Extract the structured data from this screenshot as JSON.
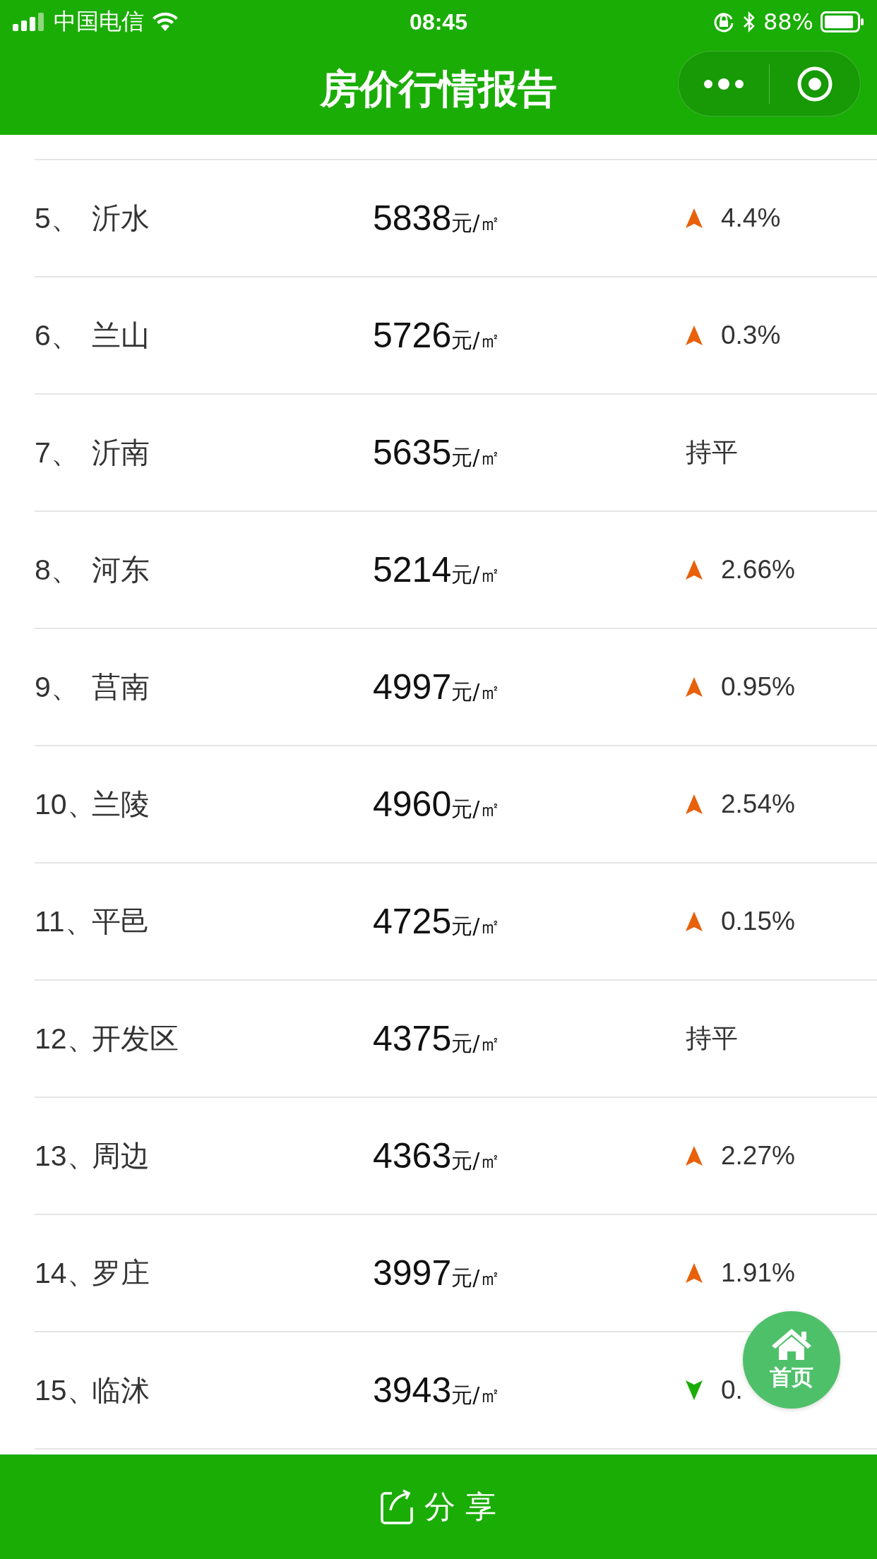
{
  "status_bar": {
    "carrier": "中国电信",
    "time": "08:45",
    "battery": "88%"
  },
  "nav_bar": {
    "title": "房价行情报告"
  },
  "rows": [
    {
      "rank": "5、",
      "name": "沂水",
      "price": "5838",
      "unit": "元/㎡",
      "trend": {
        "kind": "up",
        "text": "4.4%"
      }
    },
    {
      "rank": "6、",
      "name": "兰山",
      "price": "5726",
      "unit": "元/㎡",
      "trend": {
        "kind": "up",
        "text": "0.3%"
      }
    },
    {
      "rank": "7、",
      "name": "沂南",
      "price": "5635",
      "unit": "元/㎡",
      "trend": {
        "kind": "flat",
        "text": "持平"
      }
    },
    {
      "rank": "8、",
      "name": "河东",
      "price": "5214",
      "unit": "元/㎡",
      "trend": {
        "kind": "up",
        "text": "2.66%"
      }
    },
    {
      "rank": "9、",
      "name": "莒南",
      "price": "4997",
      "unit": "元/㎡",
      "trend": {
        "kind": "up",
        "text": "0.95%"
      }
    },
    {
      "rank": "10、",
      "name": "兰陵",
      "price": "4960",
      "unit": "元/㎡",
      "trend": {
        "kind": "up",
        "text": "2.54%"
      }
    },
    {
      "rank": "11、",
      "name": "平邑",
      "price": "4725",
      "unit": "元/㎡",
      "trend": {
        "kind": "up",
        "text": "0.15%"
      }
    },
    {
      "rank": "12、",
      "name": "开发区",
      "price": "4375",
      "unit": "元/㎡",
      "trend": {
        "kind": "flat",
        "text": "持平"
      }
    },
    {
      "rank": "13、",
      "name": "周边",
      "price": "4363",
      "unit": "元/㎡",
      "trend": {
        "kind": "up",
        "text": "2.27%"
      }
    },
    {
      "rank": "14、",
      "name": "罗庄",
      "price": "3997",
      "unit": "元/㎡",
      "trend": {
        "kind": "up",
        "text": "1.91%"
      }
    },
    {
      "rank": "15、",
      "name": "临沭",
      "price": "3943",
      "unit": "元/㎡",
      "trend": {
        "kind": "down",
        "text": "0."
      }
    }
  ],
  "home_button": {
    "label": "首页"
  },
  "share_bar": {
    "label": "分 享"
  }
}
